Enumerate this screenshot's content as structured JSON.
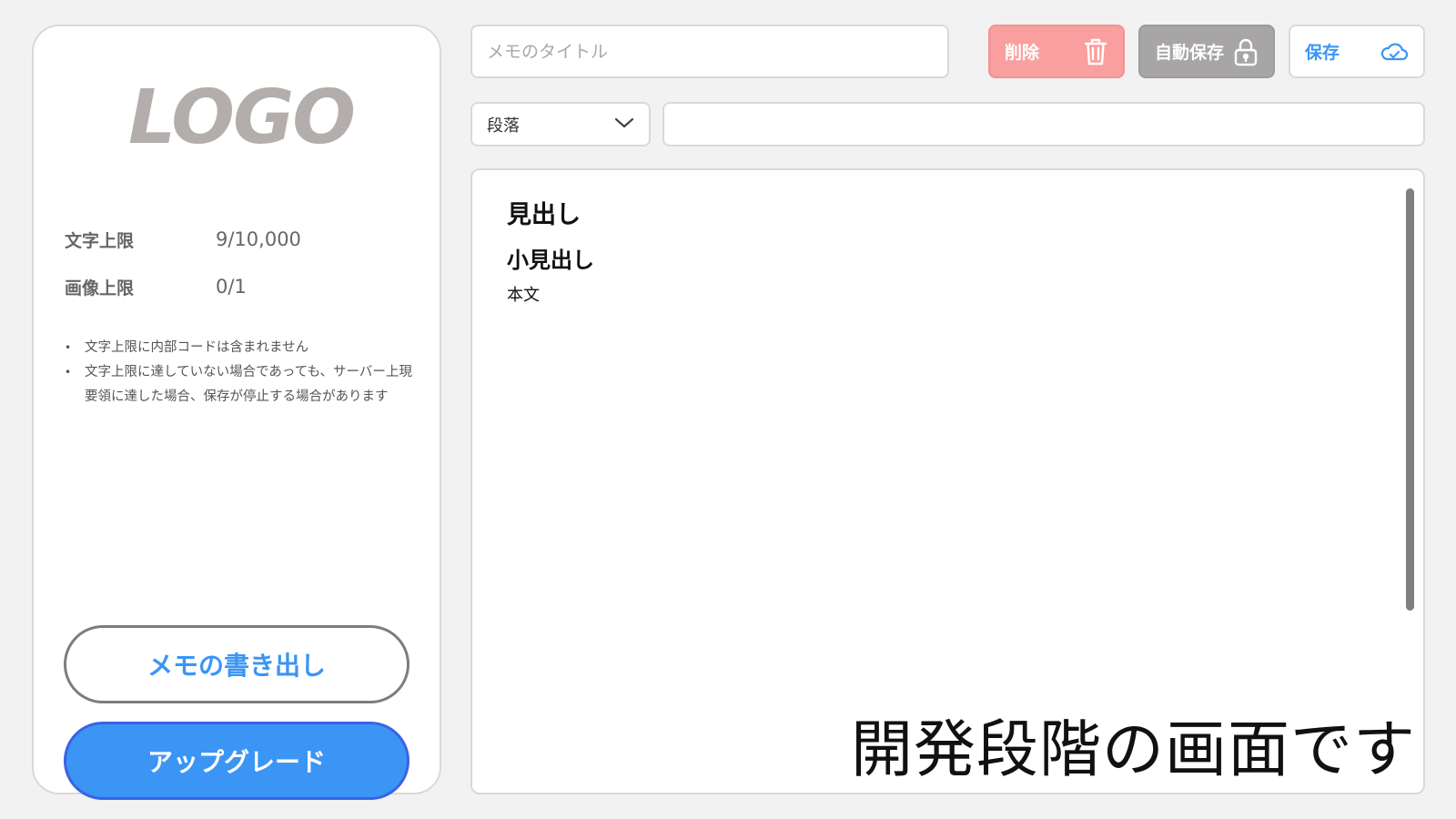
{
  "sidebar": {
    "logo": "LOGO",
    "limits": [
      {
        "label": "文字上限",
        "value": "9/10,000"
      },
      {
        "label": "画像上限",
        "value": "0/1"
      }
    ],
    "notes": [
      "文字上限に内部コードは含まれません",
      "文字上限に達していない場合であっても、サーバー上現要領に達した場合、保存が停止する場合があります"
    ],
    "export_label": "メモの書き出し",
    "upgrade_label": "アップグレード"
  },
  "header": {
    "title_placeholder": "メモのタイトル",
    "title_value": "",
    "delete_label": "削除",
    "delete_icon": "trash-icon",
    "autosave_label": "自動保存",
    "autosave_icon": "lock-icon",
    "save_label": "保存",
    "save_icon": "cloud-icon"
  },
  "format": {
    "paragraph_selected": "段落",
    "dropdown_icon": "chevron-down-icon"
  },
  "editor": {
    "heading": "見出し",
    "subheading": "小見出し",
    "body": "本文"
  },
  "overlay": {
    "dev_note": "開発段階の画面です"
  },
  "colors": {
    "accent": "#3b95f5",
    "delete_bg": "#fa9f9f",
    "autosave_bg": "#a7a5a5",
    "logo": "#b3aeac"
  }
}
